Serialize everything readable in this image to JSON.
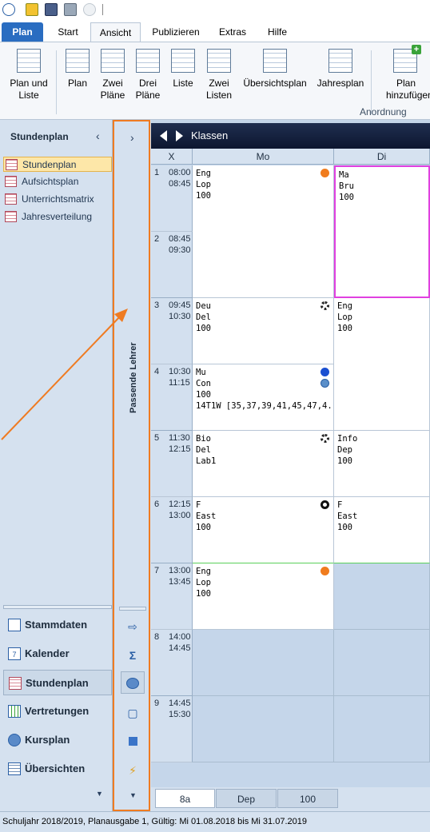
{
  "ribbon": {
    "tabs": {
      "plan": "Plan",
      "start": "Start",
      "ansicht": "Ansicht",
      "publizieren": "Publizieren",
      "extras": "Extras",
      "hilfe": "Hilfe"
    },
    "buttons": {
      "plan_und_liste": [
        "Plan und",
        "Liste"
      ],
      "plan": "Plan",
      "zwei_plaene": [
        "Zwei",
        "Pläne"
      ],
      "drei_plaene": [
        "Drei",
        "Pläne"
      ],
      "liste": "Liste",
      "zwei_listen": [
        "Zwei",
        "Listen"
      ],
      "uebersichtsplan": "Übersichtsplan",
      "jahresplan": "Jahresplan",
      "plan_hinzufuegen": [
        "Plan",
        "hinzufügen"
      ]
    },
    "group_label": "Anordnung"
  },
  "sidebar": {
    "title": "Stundenplan",
    "items": [
      "Stundenplan",
      "Aufsichtsplan",
      "Unterrichtsmatrix",
      "Jahresverteilung"
    ],
    "nav": [
      "Stammdaten",
      "Kalender",
      "Stundenplan",
      "Vertretungen",
      "Kursplan",
      "Übersichten"
    ],
    "collapsed_label": "Passende Lehrer"
  },
  "grid": {
    "title": "Klassen",
    "col_x": "X",
    "days": [
      "Mo",
      "Di"
    ],
    "periods": [
      {
        "n": "1",
        "start": "08:00",
        "end": "08:45"
      },
      {
        "n": "2",
        "start": "08:45",
        "end": "09:30"
      },
      {
        "n": "3",
        "start": "09:45",
        "end": "10:30"
      },
      {
        "n": "4",
        "start": "10:30",
        "end": "11:15"
      },
      {
        "n": "5",
        "start": "11:30",
        "end": "12:15"
      },
      {
        "n": "6",
        "start": "12:15",
        "end": "13:00"
      },
      {
        "n": "7",
        "start": "13:00",
        "end": "13:45"
      },
      {
        "n": "8",
        "start": "14:00",
        "end": "14:45"
      },
      {
        "n": "9",
        "start": "14:45",
        "end": "15:30"
      }
    ],
    "mo": [
      {
        "l1": "Eng",
        "l2": "Lop",
        "l3": "100",
        "l4": ""
      },
      {
        "l1": "Deu",
        "l2": "Del",
        "l3": "100",
        "l4": ""
      },
      {
        "l1": "Mu",
        "l2": "Con",
        "l3": "100",
        "l4": "14T1W  [35,37,39,41,45,47,4..."
      },
      {
        "l1": "Bio",
        "l2": "Del",
        "l3": "Lab1",
        "l4": ""
      },
      {
        "l1": "F",
        "l2": "East",
        "l3": "100",
        "l4": ""
      },
      {
        "l1": "Eng",
        "l2": "Lop",
        "l3": "100",
        "l4": ""
      }
    ],
    "di": [
      {
        "l1": "Ma",
        "l2": "Bru",
        "l3": "100"
      },
      {
        "l1": "Eng",
        "l2": "Lop",
        "l3": "100"
      },
      {
        "l1": "Info",
        "l2": "Dep",
        "l3": "100"
      },
      {
        "l1": "F",
        "l2": "East",
        "l3": "100"
      }
    ],
    "bottom_tabs": [
      "8a",
      "Dep",
      "100"
    ]
  },
  "status": "Schuljahr 2018/2019, Planausgabe 1, Gültig: Mi 01.08.2018 bis Mi 31.07.2019",
  "colors": {
    "accent": "#2a6dc1",
    "highlight": "#ef7b22",
    "selection": "#e040e0"
  }
}
